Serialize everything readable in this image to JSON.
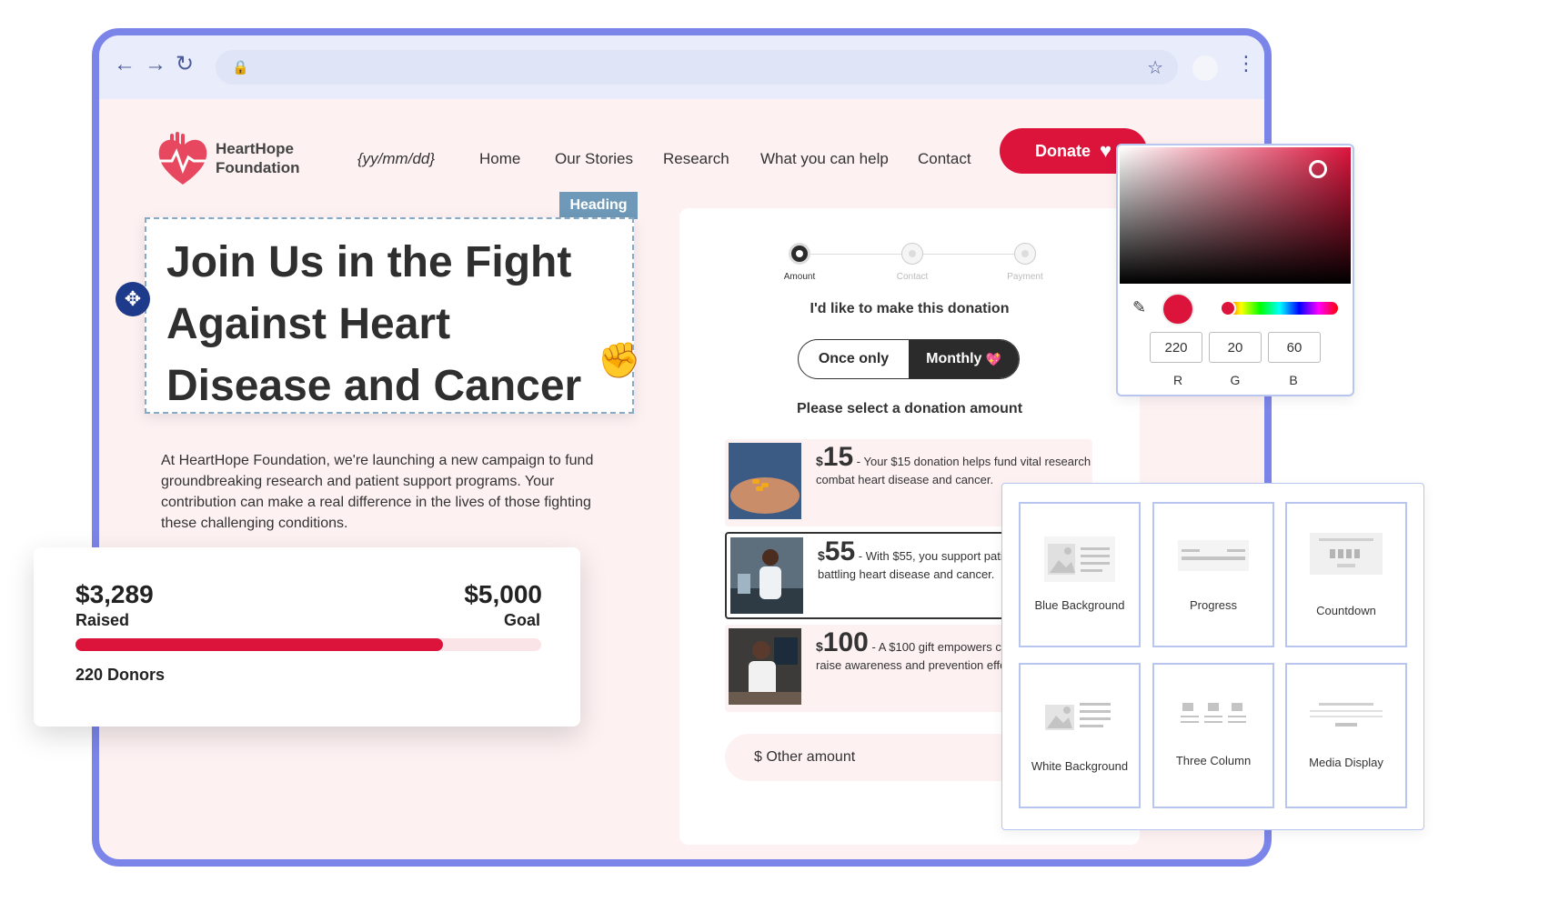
{
  "browser": {
    "back": "←",
    "forward": "→",
    "reload": "↻",
    "lock": "🔒",
    "bookmark": "☆",
    "menu": "⋮"
  },
  "site": {
    "logo_line1": "HeartHope",
    "logo_line2": "Foundation",
    "nav": [
      "{yy/mm/dd}",
      "Home",
      "Our Stories",
      "Research",
      "What you can help",
      "Contact"
    ],
    "donate_label": "Donate",
    "donate_icon": "♥"
  },
  "editor": {
    "heading_tag": "Heading",
    "heading": "Join Us in the Fight Against Heart Disease and Cancer"
  },
  "intro": "At HeartHope Foundation, we're launching a new campaign to fund groundbreaking research and patient support programs. Your contribution can make a real difference in the lives of those fighting these challenging conditions.",
  "form": {
    "steps": [
      "Amount",
      "Contact",
      "Payment"
    ],
    "title": "I'd like to make this donation",
    "frequency": [
      "Once only",
      "Monthly"
    ],
    "monthly_icon": "💖",
    "amount_prompt": "Please select a donation amount",
    "amounts": [
      {
        "currency": "$",
        "value": "15",
        "desc": " - Your $15 donation helps fund vital research to combat heart disease and cancer."
      },
      {
        "currency": "$",
        "value": "55",
        "desc": " - With $55, you support patient programs for those battling heart disease and cancer."
      },
      {
        "currency": "$",
        "value": "100",
        "desc": " - A $100 gift empowers community outreach to raise awareness and prevention efforts."
      }
    ],
    "other_amount": "$ Other amount"
  },
  "progress": {
    "raised": "$3,289",
    "raised_label": "Raised",
    "goal": "$5,000",
    "goal_label": "Goal",
    "fraction": 0.79,
    "donors": "220 Donors"
  },
  "picker": {
    "r": "220",
    "g": "20",
    "b": "60",
    "r_label": "R",
    "g_label": "G",
    "b_label": "B",
    "color": "#dc143c"
  },
  "blocks": [
    "Blue Background",
    "Progress",
    "Countdown",
    "White Background",
    "Three Column",
    "Media Display"
  ]
}
